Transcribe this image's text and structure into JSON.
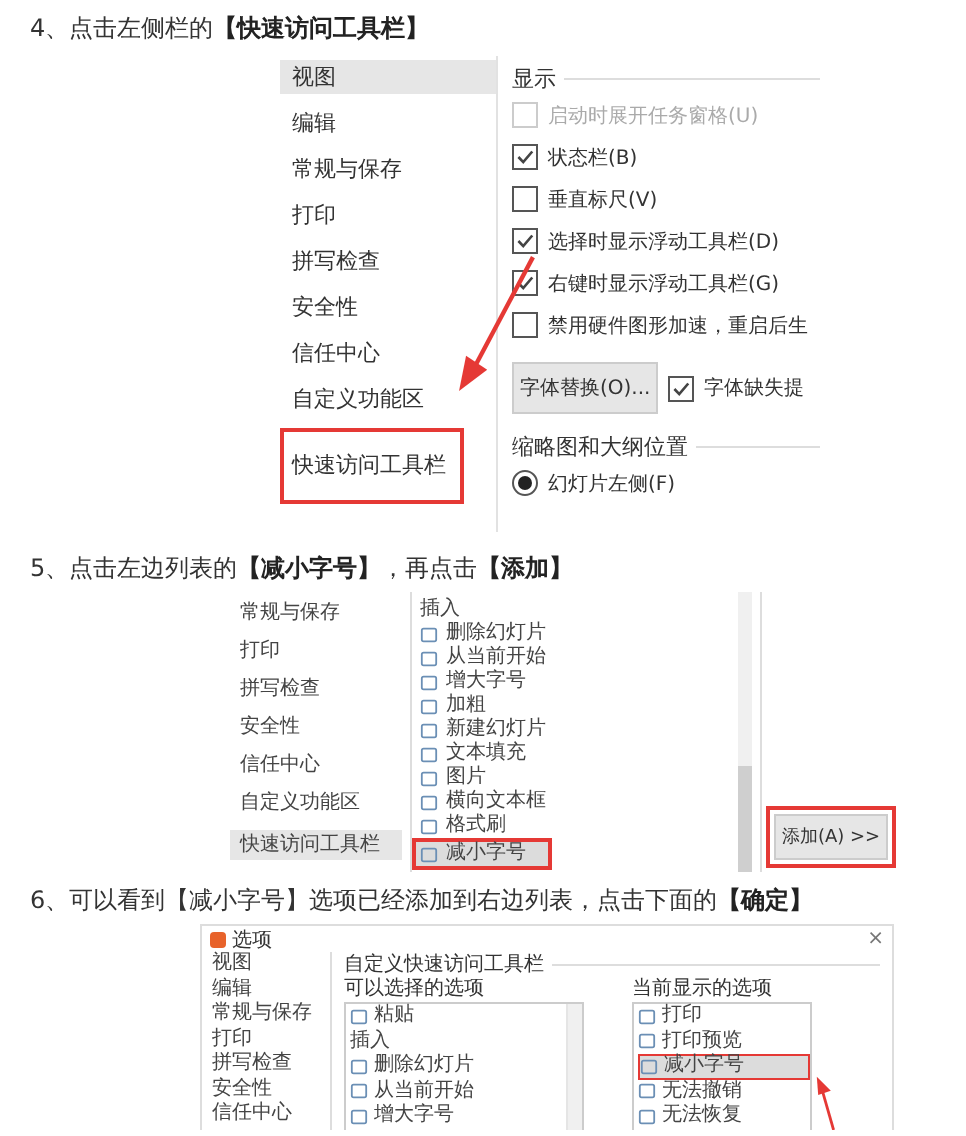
{
  "steps": [
    {
      "heading": "4、点击左侧栏的**【快速访问工具栏】**",
      "sidebar": [
        {
          "label": "视图",
          "selected": true,
          "highlighted": false
        },
        {
          "label": "编辑",
          "selected": false,
          "highlighted": false
        },
        {
          "label": "常规与保存",
          "selected": false,
          "highlighted": false
        },
        {
          "label": "打印",
          "selected": false,
          "highlighted": false
        },
        {
          "label": "拼写检查",
          "selected": false,
          "highlighted": false
        },
        {
          "label": "安全性",
          "selected": false,
          "highlighted": false
        },
        {
          "label": "信任中心",
          "selected": false,
          "highlighted": false
        },
        {
          "label": "自定义功能区",
          "selected": false,
          "highlighted": false
        },
        {
          "label": "快速访问工具栏",
          "selected": false,
          "highlighted": true
        }
      ],
      "display_group": {
        "title": "显示",
        "options": [
          {
            "label": "启动时展开任务窗格(U)",
            "checked": false,
            "disabled": true
          },
          {
            "label": "状态栏(B)",
            "checked": true,
            "disabled": false
          },
          {
            "label": "垂直标尺(V)",
            "checked": false,
            "disabled": false
          },
          {
            "label": "选择时显示浮动工具栏(D)",
            "checked": true,
            "disabled": false
          },
          {
            "label": "右键时显示浮动工具栏(G)",
            "checked": true,
            "disabled": false
          },
          {
            "label": "禁用硬件图形加速，重启后生",
            "checked": false,
            "disabled": false
          }
        ]
      },
      "font_button": "字体替换(O)...",
      "font_option": {
        "label": "字体缺失提",
        "checked": true
      },
      "position_group": {
        "title": "缩略图和大纲位置",
        "options": [
          {
            "label": "幻灯片左侧(F)",
            "selected": true
          }
        ]
      }
    },
    {
      "heading": "5、点击左边列表的**【减小字号】**，再点击**【添加】**",
      "sidebar": [
        {
          "label": "常规与保存",
          "selected": false
        },
        {
          "label": "打印",
          "selected": false
        },
        {
          "label": "拼写检查",
          "selected": false
        },
        {
          "label": "安全性",
          "selected": false
        },
        {
          "label": "信任中心",
          "selected": false
        },
        {
          "label": "自定义功能区",
          "selected": false
        },
        {
          "label": "快速访问工具栏",
          "selected": true
        }
      ],
      "commands": [
        {
          "kind": "header",
          "label": "插入",
          "selected": false
        },
        {
          "kind": "command",
          "label": "删除幻灯片",
          "selected": false
        },
        {
          "kind": "command",
          "label": "从当前开始",
          "selected": false
        },
        {
          "kind": "command",
          "label": "增大字号",
          "selected": false
        },
        {
          "kind": "command",
          "label": "加粗",
          "selected": false
        },
        {
          "kind": "command",
          "label": "新建幻灯片",
          "selected": false
        },
        {
          "kind": "command",
          "label": "文本填充",
          "selected": false
        },
        {
          "kind": "command",
          "label": "图片",
          "selected": false
        },
        {
          "kind": "command",
          "label": "横向文本框",
          "selected": false
        },
        {
          "kind": "command",
          "label": "格式刷",
          "selected": false
        },
        {
          "kind": "command",
          "label": "减小字号",
          "selected": true
        }
      ],
      "add_button": {
        "label": "添加(A) >>",
        "highlighted": true
      }
    },
    {
      "heading": "6、可以看到【减小字号】选项已经添加到右边列表，点击下面的**【确定】**",
      "dialog": {
        "title": "选项",
        "close": "×",
        "sidebar": [
          {
            "label": "视图",
            "selected": false
          },
          {
            "label": "编辑",
            "selected": false
          },
          {
            "label": "常规与保存",
            "selected": false
          },
          {
            "label": "打印",
            "selected": false
          },
          {
            "label": "拼写检查",
            "selected": false
          },
          {
            "label": "安全性",
            "selected": false
          },
          {
            "label": "信任中心",
            "selected": false
          }
        ],
        "group_title": "自定义快速访问工具栏",
        "available_title": "可以选择的选项",
        "available": [
          {
            "kind": "command",
            "label": "粘贴",
            "selected": false
          },
          {
            "kind": "header",
            "label": "插入",
            "selected": false
          },
          {
            "kind": "command",
            "label": "删除幻灯片",
            "selected": false
          },
          {
            "kind": "command",
            "label": "从当前开始",
            "selected": false
          },
          {
            "kind": "command",
            "label": "增大字号",
            "selected": false
          }
        ],
        "current_title": "当前显示的选项",
        "current": [
          {
            "label": "打印",
            "selected": false
          },
          {
            "label": "打印预览",
            "selected": false
          },
          {
            "label": "减小字号",
            "selected": true
          },
          {
            "label": "无法撤销",
            "selected": false
          },
          {
            "label": "无法恢复",
            "selected": false
          }
        ]
      }
    }
  ]
}
